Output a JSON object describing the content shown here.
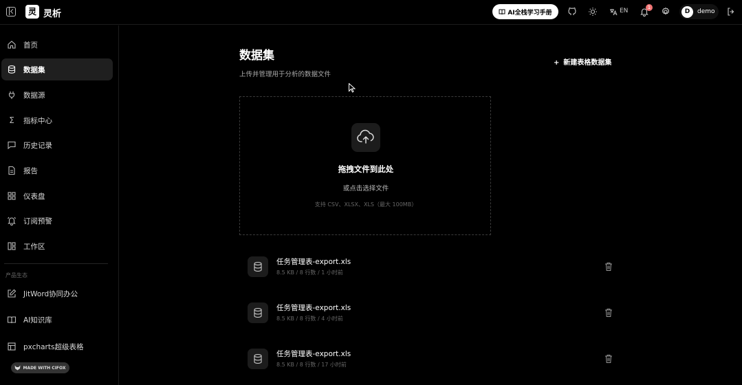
{
  "app": {
    "logo_char": "灵",
    "name": "灵析"
  },
  "topbar": {
    "manual_label": "AI全栈学习手册",
    "lang_label": "EN",
    "notification_count": "1",
    "user_initial": "D",
    "user_name": "demo"
  },
  "sidebar": {
    "items": [
      {
        "label": "首页",
        "icon": "home-icon",
        "active": false
      },
      {
        "label": "数据集",
        "icon": "database-icon",
        "active": true
      },
      {
        "label": "数据源",
        "icon": "plug-icon",
        "active": false
      },
      {
        "label": "指标中心",
        "icon": "sigma-icon",
        "active": false
      },
      {
        "label": "历史记录",
        "icon": "chat-history-icon",
        "active": false
      },
      {
        "label": "报告",
        "icon": "report-icon",
        "active": false
      },
      {
        "label": "仪表盘",
        "icon": "dashboard-icon",
        "active": false
      },
      {
        "label": "订阅预警",
        "icon": "bell-alert-icon",
        "active": false
      },
      {
        "label": "工作区",
        "icon": "workspace-icon",
        "active": false
      }
    ],
    "section_label": "产品生态",
    "ecosystem": [
      {
        "label": "JitWord协同办公",
        "icon": "edit-icon"
      },
      {
        "label": "AI知识库",
        "icon": "book-icon"
      },
      {
        "label": "pxcharts超级表格",
        "icon": "table-icon"
      }
    ],
    "badge_label": "MADE WITH CIFOX"
  },
  "main": {
    "title": "数据集",
    "subtitle": "上传并管理用于分析的数据文件",
    "new_button": "新建表格数据集",
    "dropzone": {
      "title": "拖拽文件到此处",
      "subtitle": "或点击选择文件",
      "hint": "支持 CSV、XLSX、XLS（最大 100MB）"
    },
    "files": [
      {
        "name": "任务管理表-export.xls",
        "meta": "8.5 KB / 8 行数 / 1 小时前"
      },
      {
        "name": "任务管理表-export.xls",
        "meta": "8.5 KB / 8 行数 / 4 小时前"
      },
      {
        "name": "任务管理表-export.xls",
        "meta": "8.5 KB / 8 行数 / 17 小时前"
      }
    ]
  },
  "colors": {
    "background": "#000000",
    "accent": "#ffffff",
    "badge": "#f07575"
  }
}
